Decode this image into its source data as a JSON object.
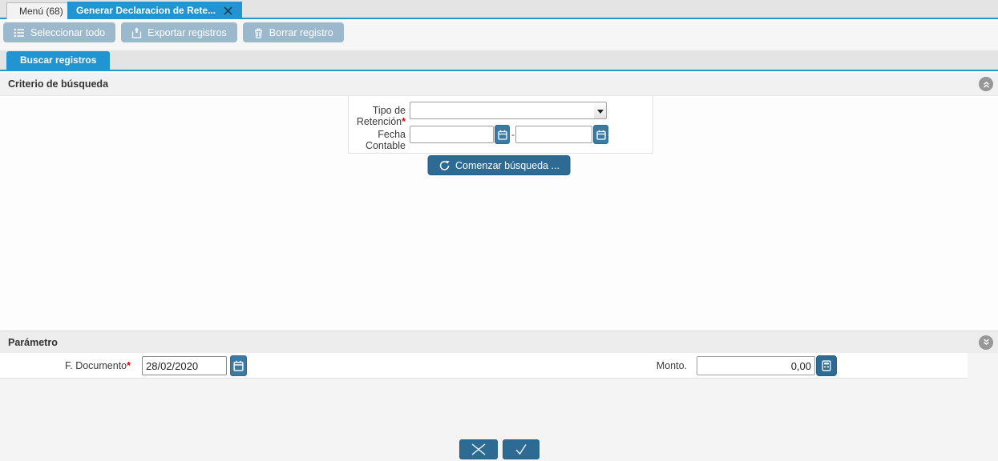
{
  "top_tabs": {
    "menu_label": "Menú (68)",
    "active_label": "Generar Declaracion de Rete..."
  },
  "toolbar": {
    "buttons": [
      {
        "label": "Seleccionar todo",
        "icon": "list-icon"
      },
      {
        "label": "Exportar registros",
        "icon": "export-icon"
      },
      {
        "label": "Borrar registro",
        "icon": "trash-icon"
      }
    ]
  },
  "search_tab_label": "Buscar registros",
  "criteria_section": {
    "title": "Criterio de búsqueda",
    "tipo_retencion_label": "Tipo de Retención",
    "required_mark": "*",
    "tipo_retencion_value": "",
    "fecha_contable_label": "Fecha Contable",
    "fecha_desde_value": "",
    "fecha_hasta_value": "",
    "range_separator": "-",
    "search_button_label": "Comenzar búsqueda ..."
  },
  "parameter_section": {
    "title": "Parámetro",
    "f_documento_label": "F. Documento",
    "required_mark": "*",
    "f_documento_value": "28/02/2020",
    "monto_label": "Monto.",
    "monto_value": "0,00"
  },
  "icons": {
    "collapse": "chevrons-up-icon",
    "expand": "chevrons-down-icon",
    "cancel": "x-icon",
    "confirm": "check-icon",
    "calendar": "calendar-icon",
    "calculator": "calculator-icon",
    "refresh": "refresh-icon",
    "dropdown": "caret-down-icon",
    "close": "close-icon"
  },
  "colors": {
    "accent_blue": "#2095d1",
    "action_blue": "#2e6b94",
    "disabled_toolbar_blue": "#9cb8cc",
    "calendar_button_blue": "#3a7aa3",
    "required_red": "#e00000"
  }
}
